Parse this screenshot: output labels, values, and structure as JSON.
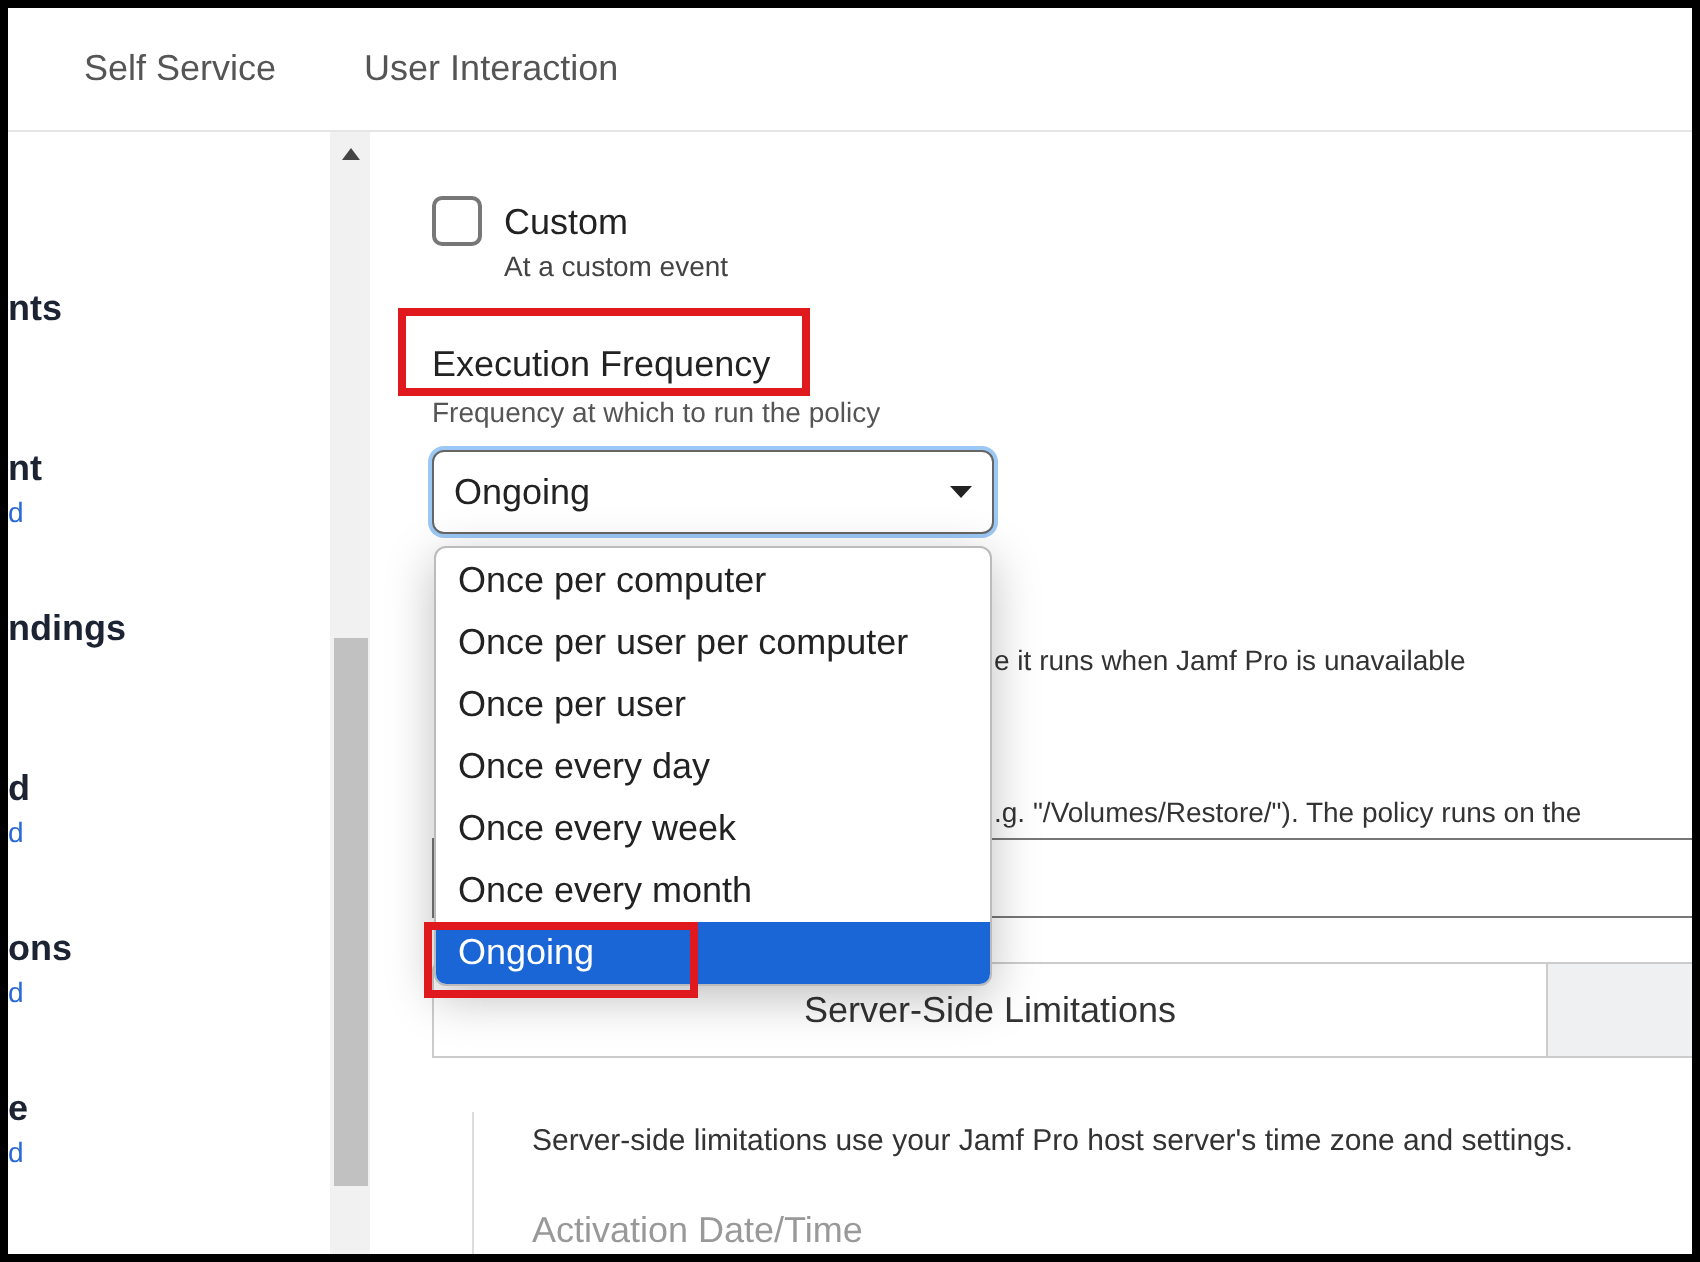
{
  "header_tabs": [
    "Self Service",
    "User Interaction"
  ],
  "sidebar": {
    "items": [
      {
        "title": "nts"
      },
      {
        "title": "nt",
        "subtitle": "d"
      },
      {
        "title": "ndings"
      },
      {
        "title": "d",
        "subtitle": "d"
      },
      {
        "title": "ons",
        "subtitle": "d"
      },
      {
        "title": "e",
        "subtitle": "d"
      }
    ]
  },
  "trigger": {
    "label": "Custom",
    "description": "At a custom event",
    "checked": false
  },
  "frequency": {
    "label": "Execution Frequency",
    "description": "Frequency at which to run the policy",
    "value": "Ongoing",
    "options": [
      {
        "label": "Once per computer",
        "selected": false
      },
      {
        "label": "Once per user per computer",
        "selected": false
      },
      {
        "label": "Once per user",
        "selected": false
      },
      {
        "label": "Once every day",
        "selected": false
      },
      {
        "label": "Once every week",
        "selected": false
      },
      {
        "label": "Once every month",
        "selected": false
      },
      {
        "label": "Ongoing",
        "selected": true
      }
    ]
  },
  "offline_note": "e it runs when Jamf Pro is unavailable",
  "path_note": ".g. \"/Volumes/Restore/\"). The policy runs on the",
  "limit_tabs": [
    {
      "label": "Server-Side Limitations",
      "selected": true
    },
    {
      "selected": false
    }
  ],
  "panel": {
    "description": "Server-side limitations use your Jamf Pro host server's time zone and settings.",
    "field_label": "Activation Date/Time"
  }
}
